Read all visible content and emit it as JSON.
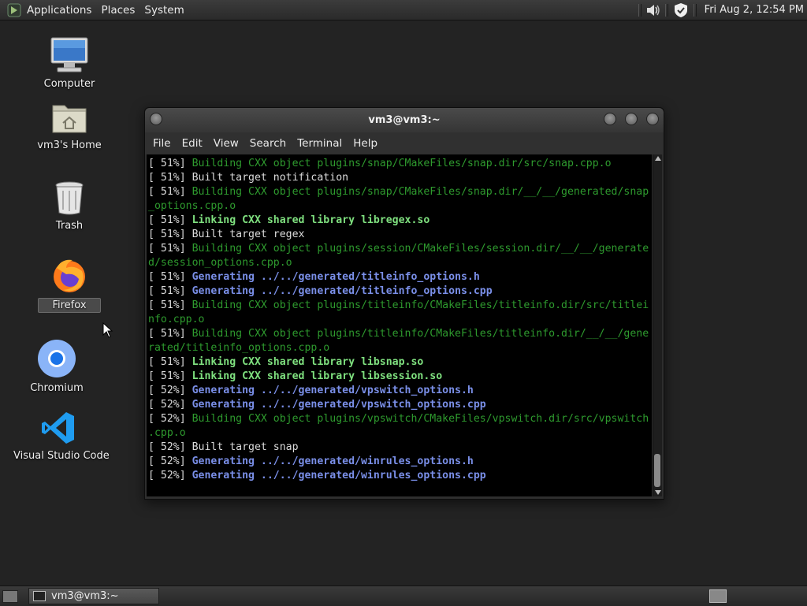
{
  "top_panel": {
    "menus": [
      "Applications",
      "Places",
      "System"
    ],
    "clock": "Fri Aug  2, 12:54 PM",
    "icons": [
      "volume-icon",
      "security-shield-icon"
    ]
  },
  "desktop_icons": [
    {
      "label": "Computer",
      "icon": "computer-icon"
    },
    {
      "label": "vm3's Home",
      "icon": "home-folder-icon"
    },
    {
      "label": "Trash",
      "icon": "trash-icon"
    },
    {
      "label": "Firefox",
      "icon": "firefox-icon",
      "selected": true
    },
    {
      "label": "Chromium",
      "icon": "chromium-icon"
    },
    {
      "label": "Visual Studio Code",
      "icon": "vscode-icon"
    }
  ],
  "terminal": {
    "title": "vm3@vm3:~",
    "menu": [
      "File",
      "Edit",
      "View",
      "Search",
      "Terminal",
      "Help"
    ],
    "lines": [
      {
        "pct": "[ 51%]",
        "text": " Building CXX object plugins/snap/CMakeFiles/snap.dir/src/snap.cpp.o",
        "style": "green"
      },
      {
        "pct": "[ 51%]",
        "text": " Built target notification",
        "style": "plain"
      },
      {
        "pct": "[ 51%]",
        "text": " Building CXX object plugins/snap/CMakeFiles/snap.dir/__/__/generated/snap",
        "style": "green"
      },
      {
        "pct": "",
        "text": "_options.cpp.o",
        "style": "green"
      },
      {
        "pct": "[ 51%]",
        "text": " Linking CXX shared library libregex.so",
        "style": "link"
      },
      {
        "pct": "[ 51%]",
        "text": " Built target regex",
        "style": "plain"
      },
      {
        "pct": "[ 51%]",
        "text": " Building CXX object plugins/session/CMakeFiles/session.dir/__/__/generate",
        "style": "green"
      },
      {
        "pct": "",
        "text": "d/session_options.cpp.o",
        "style": "green"
      },
      {
        "pct": "[ 51%]",
        "text": " Generating ../../generated/titleinfo_options.h",
        "style": "gen"
      },
      {
        "pct": "[ 51%]",
        "text": " Generating ../../generated/titleinfo_options.cpp",
        "style": "gen"
      },
      {
        "pct": "[ 51%]",
        "text": " Building CXX object plugins/titleinfo/CMakeFiles/titleinfo.dir/src/titlei",
        "style": "green"
      },
      {
        "pct": "",
        "text": "nfo.cpp.o",
        "style": "green"
      },
      {
        "pct": "[ 51%]",
        "text": " Building CXX object plugins/titleinfo/CMakeFiles/titleinfo.dir/__/__/gene",
        "style": "green"
      },
      {
        "pct": "",
        "text": "rated/titleinfo_options.cpp.o",
        "style": "green"
      },
      {
        "pct": "[ 51%]",
        "text": " Linking CXX shared library libsnap.so",
        "style": "link"
      },
      {
        "pct": "[ 51%]",
        "text": " Linking CXX shared library libsession.so",
        "style": "link"
      },
      {
        "pct": "[ 52%]",
        "text": " Generating ../../generated/vpswitch_options.h",
        "style": "gen"
      },
      {
        "pct": "[ 52%]",
        "text": " Generating ../../generated/vpswitch_options.cpp",
        "style": "gen"
      },
      {
        "pct": "[ 52%]",
        "text": " Building CXX object plugins/vpswitch/CMakeFiles/vpswitch.dir/src/vpswitch",
        "style": "green"
      },
      {
        "pct": "",
        "text": ".cpp.o",
        "style": "green"
      },
      {
        "pct": "[ 52%]",
        "text": " Built target snap",
        "style": "plain"
      },
      {
        "pct": "[ 52%]",
        "text": " Generating ../../generated/winrules_options.h",
        "style": "gen"
      },
      {
        "pct": "[ 52%]",
        "text": " Generating ../../generated/winrules_options.cpp",
        "style": "gen"
      }
    ]
  },
  "taskbar": {
    "task_label": "vm3@vm3:~"
  }
}
